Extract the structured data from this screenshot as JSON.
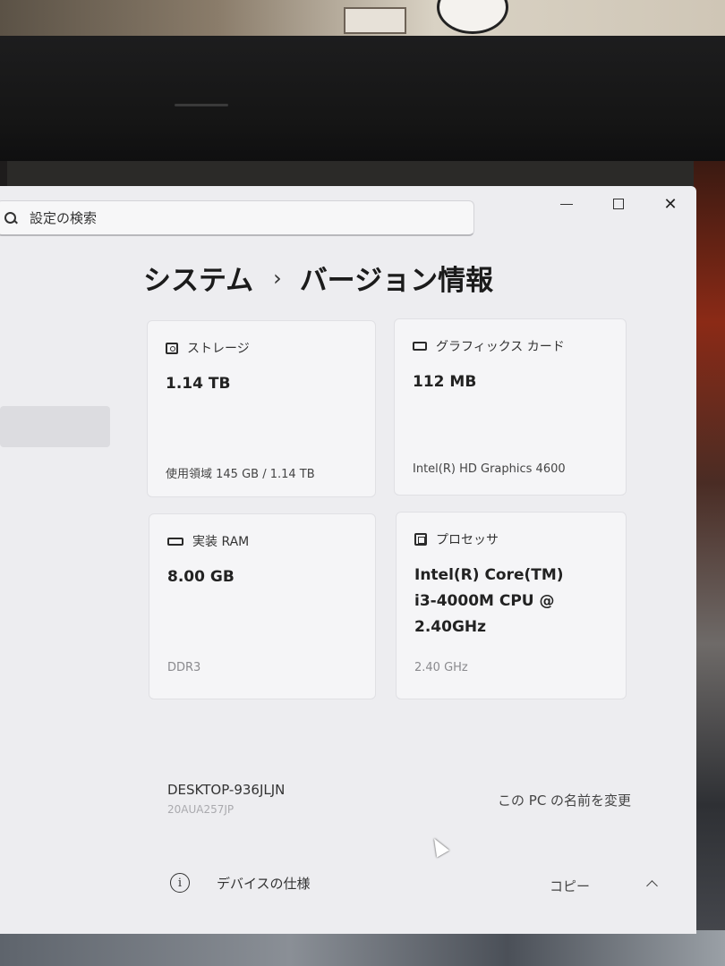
{
  "search": {
    "placeholder": "設定の検索"
  },
  "breadcrumb": {
    "parent": "システム",
    "separator": "›",
    "current": "バージョン情報"
  },
  "window_controls": {
    "close_glyph": "✕"
  },
  "cards": {
    "storage": {
      "title": "ストレージ",
      "value": "1.14 TB",
      "detail": "使用領域 145 GB / 1.14 TB",
      "icon": "disk-icon"
    },
    "graphics": {
      "title": "グラフィックス カード",
      "value": "112 MB",
      "detail": "Intel(R) HD Graphics 4600",
      "icon": "gpu-icon"
    },
    "ram": {
      "title": "実装 RAM",
      "value": "8.00 GB",
      "detail": "DDR3",
      "icon": "ram-icon"
    },
    "processor": {
      "title": "プロセッサ",
      "value": "Intel(R) Core(TM) i3-4000M CPU @ 2.40GHz",
      "detail": "2.40 GHz",
      "icon": "cpu-icon"
    }
  },
  "device": {
    "name": "DESKTOP-936JLJN",
    "model": "20AUA257JP",
    "rename_label": "この PC の名前を変更"
  },
  "specs": {
    "icon_glyph": "i",
    "label": "デバイスの仕様",
    "copy_label": "コピー"
  }
}
